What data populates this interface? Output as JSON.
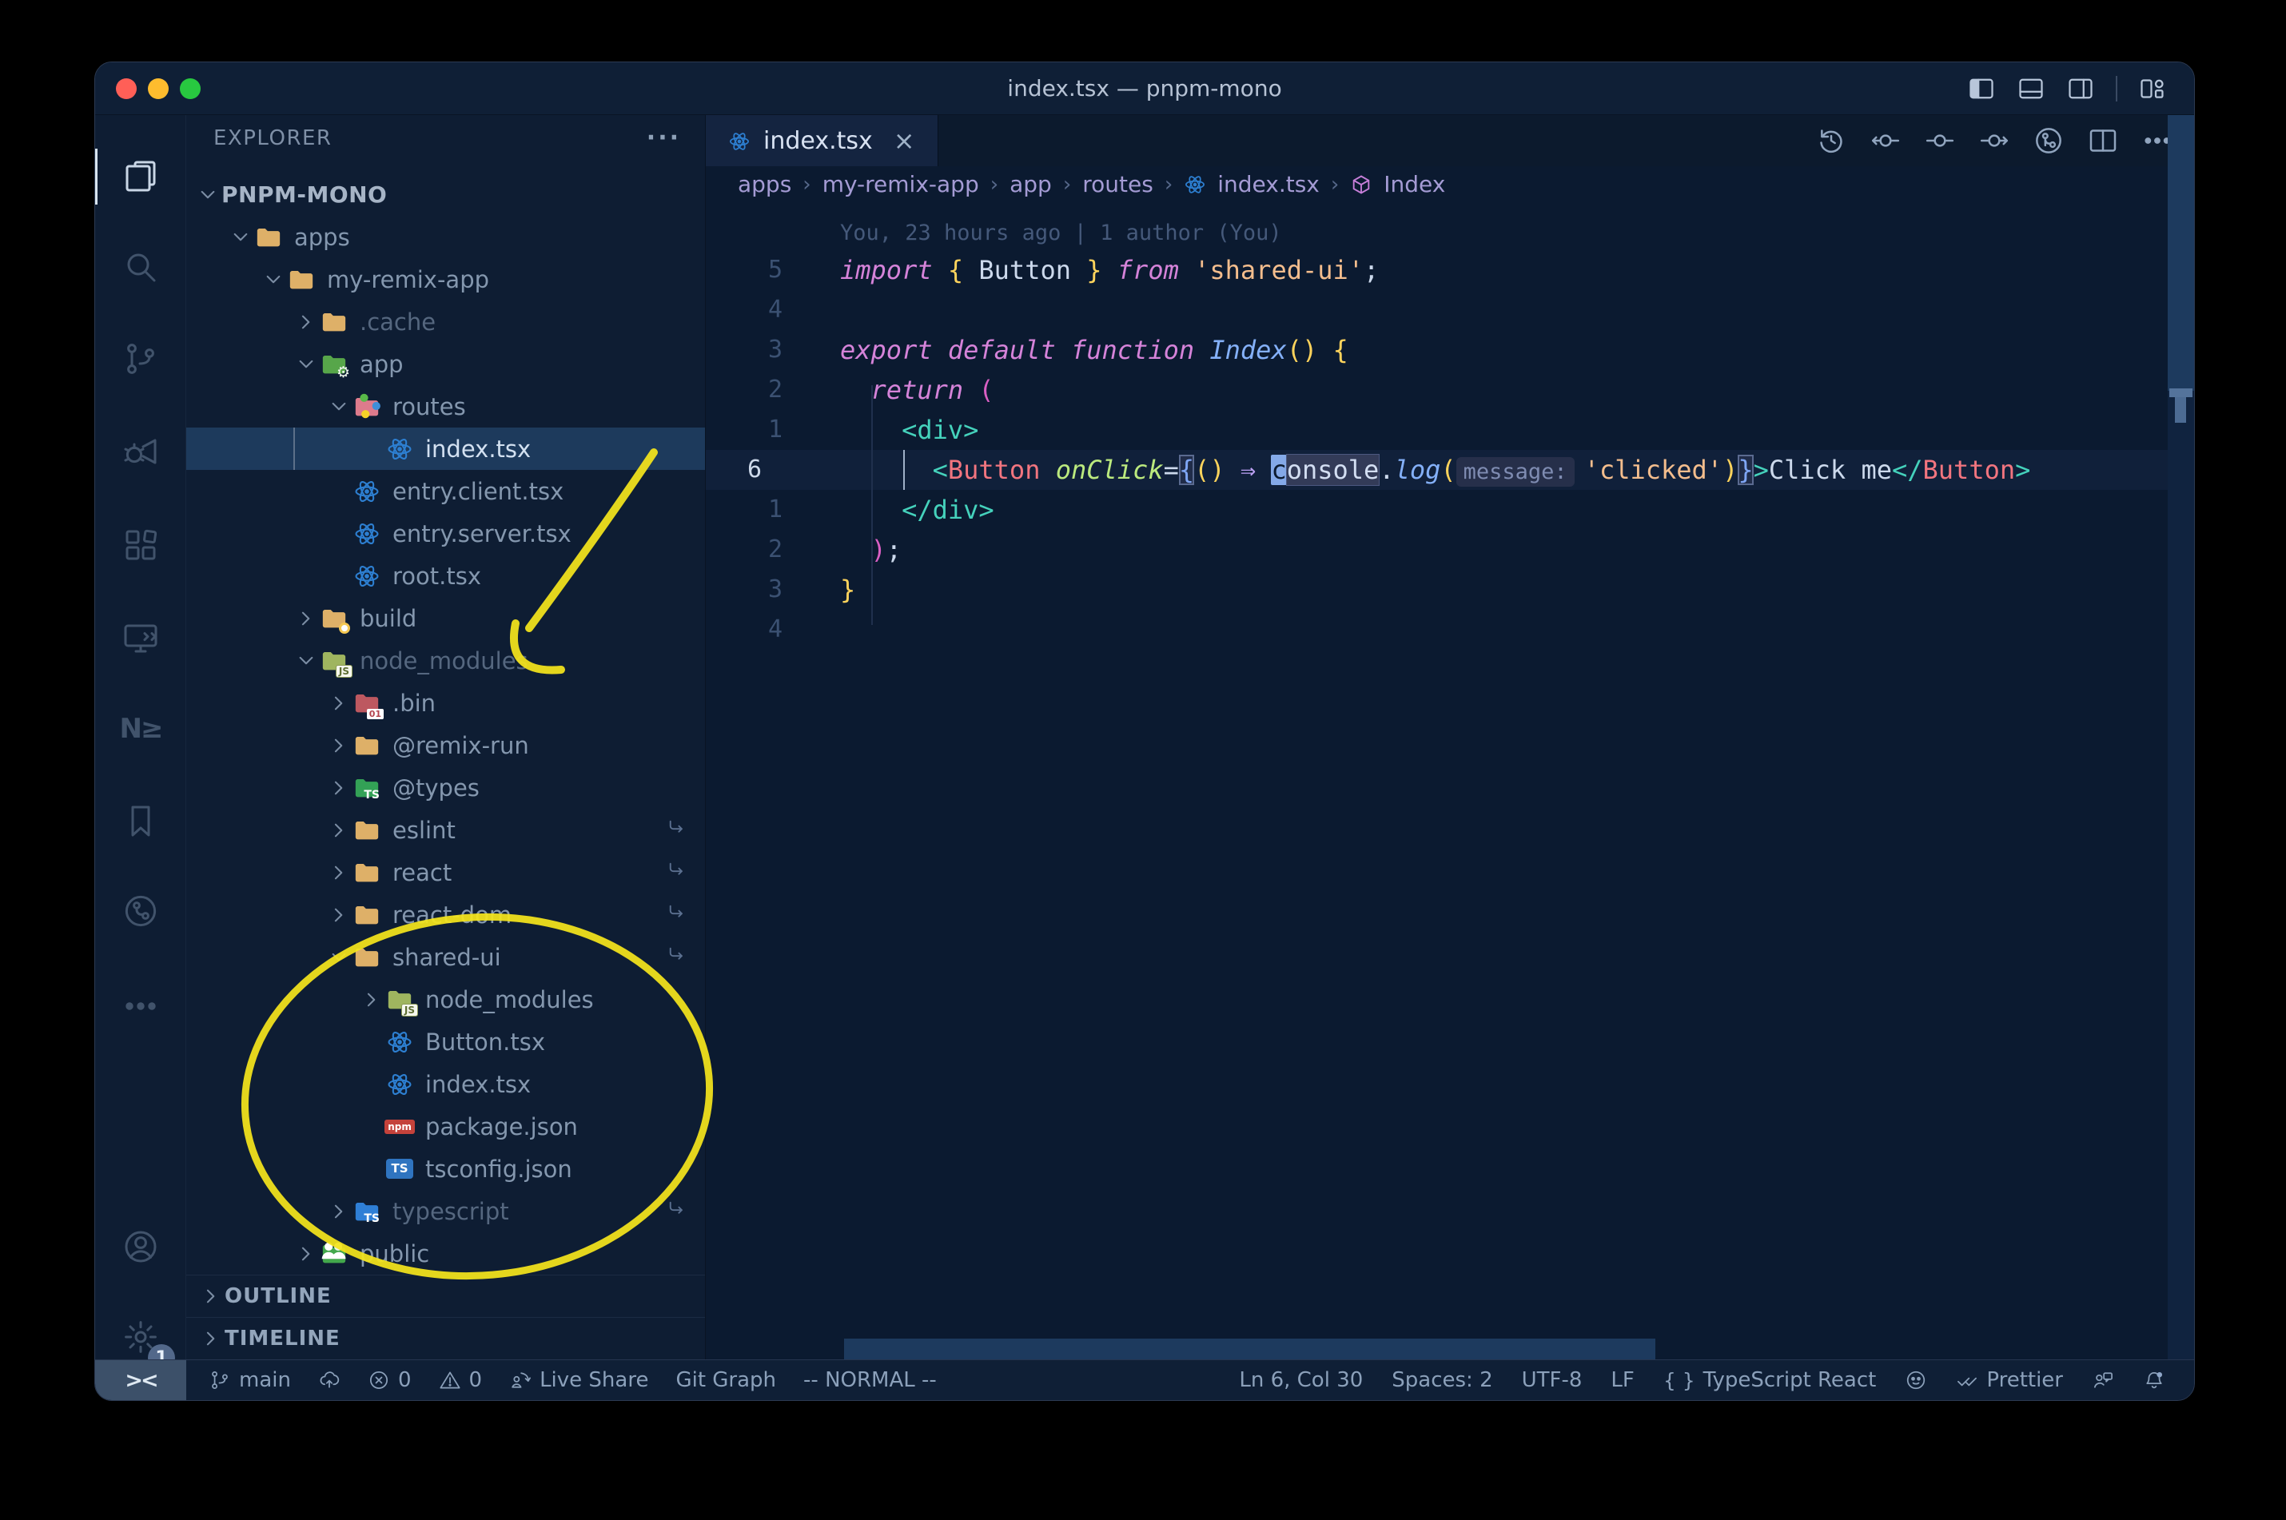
{
  "window": {
    "title": "index.tsx — pnpm-mono"
  },
  "titlebar": {
    "window_controls": [
      "layout-sidebar-left",
      "layout-panel",
      "layout-sidebar-right",
      "separator",
      "layout-customize"
    ]
  },
  "activity_bar": {
    "top": [
      {
        "name": "explorer",
        "active": true
      },
      {
        "name": "search"
      },
      {
        "name": "source-control"
      },
      {
        "name": "run-debug"
      },
      {
        "name": "extensions"
      },
      {
        "name": "remote-explorer"
      },
      {
        "name": "nx",
        "text": "N≥"
      },
      {
        "name": "bookmarks"
      },
      {
        "name": "git-graph"
      }
    ],
    "bottom": [
      {
        "name": "more"
      },
      {
        "name": "account"
      },
      {
        "name": "settings",
        "badge": "1"
      }
    ]
  },
  "sidebar": {
    "header": "EXPLORER",
    "header_menu": "···",
    "root": "PNPM-MONO",
    "tree": [
      {
        "label": "apps",
        "level": 1,
        "icon": "folder-tan",
        "expanded": true
      },
      {
        "label": "my-remix-app",
        "level": 2,
        "icon": "folder-tan",
        "expanded": true
      },
      {
        "label": ".cache",
        "level": 3,
        "icon": "folder-tan",
        "expanded": false,
        "dim": true
      },
      {
        "label": "app",
        "level": 3,
        "icon": "folder-app",
        "expanded": true
      },
      {
        "label": "routes",
        "level": 4,
        "icon": "folder-routes",
        "expanded": true
      },
      {
        "label": "index.tsx",
        "level": 5,
        "icon": "react",
        "file": true,
        "selected": true
      },
      {
        "label": "entry.client.tsx",
        "level": 4,
        "icon": "react",
        "file": true
      },
      {
        "label": "entry.server.tsx",
        "level": 4,
        "icon": "react",
        "file": true
      },
      {
        "label": "root.tsx",
        "level": 4,
        "icon": "react",
        "file": true
      },
      {
        "label": "build",
        "level": 3,
        "icon": "folder-build",
        "expanded": false
      },
      {
        "label": "node_modules",
        "level": 3,
        "icon": "folder-nm",
        "expanded": true,
        "dim": true
      },
      {
        "label": ".bin",
        "level": 4,
        "icon": "folder-bin",
        "expanded": false
      },
      {
        "label": "@remix-run",
        "level": 4,
        "icon": "folder-tan",
        "expanded": false
      },
      {
        "label": "@types",
        "level": 4,
        "icon": "folder-types",
        "expanded": false
      },
      {
        "label": "eslint",
        "level": 4,
        "icon": "folder-tan",
        "expanded": false,
        "symlink": true
      },
      {
        "label": "react",
        "level": 4,
        "icon": "folder-tan",
        "expanded": false,
        "symlink": true
      },
      {
        "label": "react-dom",
        "level": 4,
        "icon": "folder-tan",
        "expanded": false,
        "symlink": true
      },
      {
        "label": "shared-ui",
        "level": 4,
        "icon": "folder-tan",
        "expanded": true,
        "symlink": true
      },
      {
        "label": "node_modules",
        "level": 5,
        "icon": "folder-nm",
        "expanded": false
      },
      {
        "label": "Button.tsx",
        "level": 5,
        "icon": "react",
        "file": true
      },
      {
        "label": "index.tsx",
        "level": 5,
        "icon": "react",
        "file": true
      },
      {
        "label": "package.json",
        "level": 5,
        "icon": "npm",
        "file": true
      },
      {
        "label": "tsconfig.json",
        "level": 5,
        "icon": "ts",
        "file": true
      },
      {
        "label": "typescript",
        "level": 4,
        "icon": "folder-ts",
        "expanded": false,
        "dim": true,
        "symlink": true
      },
      {
        "label": "public",
        "level": 3,
        "icon": "folder-public",
        "expanded": false
      }
    ],
    "panels": [
      "OUTLINE",
      "TIMELINE"
    ]
  },
  "editor": {
    "tab": {
      "label": "index.tsx",
      "close": "×"
    },
    "actions": [
      "history",
      "gitlens-back",
      "gitlens-current",
      "gitlens-forward",
      "branch-circle",
      "split-editor",
      "more"
    ],
    "breadcrumbs": {
      "folders": [
        "apps",
        "my-remix-app",
        "app",
        "routes"
      ],
      "file": "index.tsx",
      "symbol": "Index"
    },
    "blame": "You, 23 hours ago | 1 author (You)",
    "lines": [
      {
        "num": "5",
        "indent": 0,
        "tokens": [
          [
            "import",
            "kw"
          ],
          [
            " ",
            ""
          ],
          [
            "{",
            "bry"
          ],
          [
            " Button ",
            "var"
          ],
          [
            "}",
            "bry"
          ],
          [
            " ",
            ""
          ],
          [
            "from",
            "kw"
          ],
          [
            " ",
            ""
          ],
          [
            "'shared-ui'",
            "str"
          ],
          [
            ";",
            "pun"
          ]
        ]
      },
      {
        "num": "4",
        "indent": 0,
        "tokens": []
      },
      {
        "num": "3",
        "indent": 0,
        "tokens": [
          [
            "export",
            "kw"
          ],
          [
            " ",
            ""
          ],
          [
            "default",
            "kw"
          ],
          [
            " ",
            ""
          ],
          [
            "function",
            "kw"
          ],
          [
            " ",
            ""
          ],
          [
            "Index",
            "cls"
          ],
          [
            "()",
            "bry"
          ],
          [
            " ",
            ""
          ],
          [
            "{",
            "bry"
          ]
        ]
      },
      {
        "num": "2",
        "indent": 1,
        "tokens": [
          [
            "return",
            "kw"
          ],
          [
            " ",
            ""
          ],
          [
            "(",
            "brm"
          ]
        ]
      },
      {
        "num": "1",
        "indent": 2,
        "tokens": [
          [
            "<div>",
            "tag"
          ]
        ]
      },
      {
        "num": "6",
        "indent": 3,
        "current": true,
        "tokens": [
          [
            "<",
            "tag"
          ],
          [
            "Button",
            "cmp"
          ],
          [
            " ",
            ""
          ],
          [
            "onClick",
            "attr"
          ],
          [
            "=",
            "pun"
          ],
          [
            "{",
            "brb box"
          ],
          [
            "()",
            "bry"
          ],
          [
            " ",
            ""
          ],
          [
            "⇒",
            "op"
          ],
          [
            " ",
            ""
          ],
          [
            "c",
            "cursor"
          ],
          [
            "onsole",
            "hlw"
          ],
          [
            ".",
            "pun"
          ],
          [
            "log",
            "fn"
          ],
          [
            "(",
            "bry"
          ],
          [
            "message:",
            "inlay"
          ],
          [
            "'clicked'",
            "str"
          ],
          [
            ")",
            "bry"
          ],
          [
            "}",
            "brb box"
          ],
          [
            ">",
            "tag"
          ],
          [
            "Click me",
            "pun"
          ],
          [
            "</",
            "tag"
          ],
          [
            "Button",
            "cmp"
          ],
          [
            ">",
            "tag"
          ]
        ]
      },
      {
        "num": "1",
        "indent": 2,
        "tokens": [
          [
            "</div>",
            "tag"
          ]
        ]
      },
      {
        "num": "2",
        "indent": 1,
        "tokens": [
          [
            ")",
            "brm"
          ],
          [
            ";",
            "pun"
          ]
        ]
      },
      {
        "num": "3",
        "indent": 0,
        "tokens": [
          [
            "}",
            "bry"
          ]
        ]
      },
      {
        "num": "4",
        "indent": 0,
        "tokens": []
      }
    ]
  },
  "status_bar": {
    "remote": "><",
    "left": [
      {
        "icon": "git-branch",
        "label": "main"
      },
      {
        "icon": "sync",
        "label": ""
      },
      {
        "icon": "error",
        "label": "0"
      },
      {
        "icon": "warning",
        "label": "0"
      },
      {
        "icon": "live-share",
        "label": "Live Share"
      },
      {
        "icon": "",
        "label": "Git Graph"
      },
      {
        "icon": "",
        "label": "-- NORMAL --"
      }
    ],
    "right": [
      {
        "icon": "",
        "label": "Ln 6, Col 30"
      },
      {
        "icon": "",
        "label": "Spaces: 2"
      },
      {
        "icon": "",
        "label": "UTF-8"
      },
      {
        "icon": "",
        "label": "LF"
      },
      {
        "icon": "braces",
        "label": "TypeScript React"
      },
      {
        "icon": "octoface",
        "label": ""
      },
      {
        "icon": "double-check",
        "label": "Prettier"
      },
      {
        "icon": "feedback",
        "label": ""
      },
      {
        "icon": "bell-dot",
        "label": ""
      }
    ]
  },
  "colors": {
    "annotation_yellow": "#f4e41c",
    "traffic_red": "#ff5f57",
    "traffic_yellow": "#febc2e",
    "traffic_green": "#28c840",
    "selection_row": "#1d3a5c",
    "react_blue": "#2d7fd1"
  }
}
